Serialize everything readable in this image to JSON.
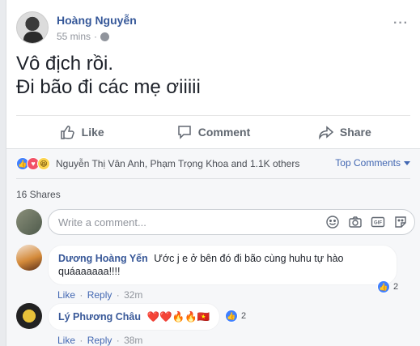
{
  "post": {
    "author": "Hoàng Nguyễn",
    "time": "55 mins",
    "more": "···",
    "text_line1": "Vô địch rồi.",
    "text_line2": "Đi bão đi các mẹ ơiiiii"
  },
  "actions": {
    "like": "Like",
    "comment": "Comment",
    "share": "Share"
  },
  "reactions": {
    "names": "Nguyễn Thị Vân Anh, Phạm Trọng Khoa and 1.1K others",
    "sort": "Top Comments",
    "shares": "16 Shares"
  },
  "compose": {
    "placeholder": "Write a comment..."
  },
  "comments": [
    {
      "name": "Dương Hoàng Yến",
      "text_line1": "Ước j e ở bên đó đi bão cùng huhu tự hào",
      "text_line2": "quáaaaaaa!!!!",
      "like": "Like",
      "reply": "Reply",
      "ago": "32m",
      "likes": "2"
    },
    {
      "name": "Lý Phương Châu",
      "text": "❤️❤️🔥🔥🇻🇳",
      "like": "Like",
      "reply": "Reply",
      "ago": "38m",
      "likes": "2"
    }
  ],
  "colors": {
    "link": "#365899",
    "like_blue": "#4080ff",
    "love_red": "#f25268",
    "haha_yellow": "#fcd44f",
    "background": "#e9ebee"
  },
  "icons": [
    "thumbs-up-icon",
    "comment-icon",
    "share-icon",
    "globe-icon",
    "smiley-icon",
    "camera-icon",
    "gif-icon",
    "sticker-icon",
    "chevron-down-icon"
  ]
}
